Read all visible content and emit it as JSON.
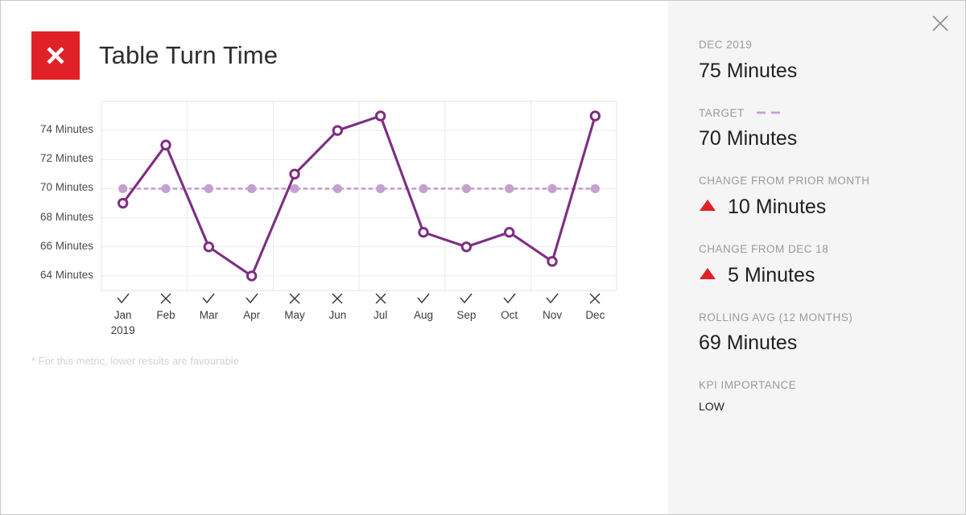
{
  "kpi": {
    "title": "Table Turn Time",
    "status_icon": "x-mark-icon",
    "status_color": "#E02127",
    "footnote": "* For this metric, lower results are favourable"
  },
  "panel": {
    "close_icon": "close-icon",
    "stats": [
      {
        "label": "DEC 2019",
        "value": "75 Minutes",
        "trend": "none",
        "legend": "none"
      },
      {
        "label": "TARGET",
        "value": "70 Minutes",
        "trend": "none",
        "legend": "dashed-line"
      },
      {
        "label": "CHANGE FROM PRIOR MONTH",
        "value": "10 Minutes",
        "trend": "up",
        "legend": "none"
      },
      {
        "label": "CHANGE FROM DEC 18",
        "value": "5 Minutes",
        "trend": "up",
        "legend": "none"
      },
      {
        "label": "ROLLING AVG (12 MONTHS)",
        "value": "69 Minutes",
        "trend": "none",
        "legend": "none"
      },
      {
        "label": "KPI IMPORTANCE",
        "value": "LOW",
        "trend": "none",
        "legend": "none",
        "small": true
      }
    ]
  },
  "chart_data": {
    "type": "line",
    "title": "Table Turn Time",
    "xlabel": "",
    "ylabel": "Minutes",
    "ylim": [
      63,
      76
    ],
    "yticks": [
      64,
      66,
      68,
      70,
      72,
      74
    ],
    "ytick_labels": [
      "64 Minutes",
      "66 Minutes",
      "68 Minutes",
      "70 Minutes",
      "72 Minutes",
      "74 Minutes"
    ],
    "grid": true,
    "legend_position": "side-panel",
    "categories": [
      "Jan",
      "Feb",
      "Mar",
      "Apr",
      "May",
      "Jun",
      "Jul",
      "Aug",
      "Sep",
      "Oct",
      "Nov",
      "Dec"
    ],
    "category_sublabels": [
      "2019",
      "",
      "",
      "",
      "",
      "",
      "",
      "",
      "",
      "",
      "",
      ""
    ],
    "status_marks": [
      "check",
      "cross",
      "check",
      "check",
      "cross",
      "cross",
      "cross",
      "check",
      "check",
      "check",
      "check",
      "cross"
    ],
    "series": [
      {
        "name": "Table Turn Time",
        "color": "#7D2E82",
        "style": "solid",
        "marker": "open-circle",
        "values": [
          69,
          73,
          66,
          64,
          71,
          74,
          75,
          67,
          66,
          67,
          65,
          75
        ]
      },
      {
        "name": "Target",
        "color": "#C5A0CE",
        "style": "dotted",
        "marker": "filled-circle",
        "values": [
          70,
          70,
          70,
          70,
          70,
          70,
          70,
          70,
          70,
          70,
          70,
          70
        ]
      }
    ]
  }
}
